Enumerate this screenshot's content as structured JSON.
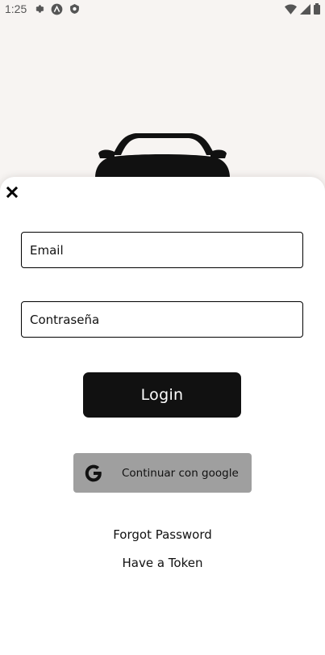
{
  "status_bar": {
    "time": "1:25",
    "left_icons": [
      "settings-icon",
      "app-icon",
      "shield-icon"
    ],
    "right_icons": [
      "wifi-icon",
      "signal-icon",
      "battery-icon"
    ]
  },
  "hero": {
    "image": "car-silhouette-icon"
  },
  "sheet": {
    "close_icon": "close-icon",
    "email_placeholder": "Email",
    "password_placeholder": "Contraseña",
    "login_label": "Login",
    "google_label": "Continuar con google",
    "forgot_password": "Forgot Password",
    "have_token": "Have a Token"
  },
  "colors": {
    "background": "#f7f4f2",
    "sheet": "#ffffff",
    "login_button": "#111111",
    "google_button": "#9f9f9f"
  }
}
